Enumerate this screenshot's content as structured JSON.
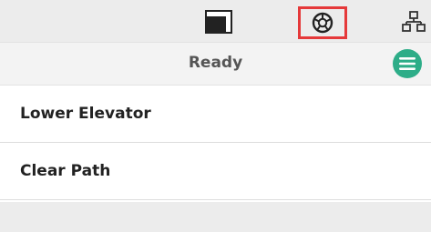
{
  "toolbar": {
    "icons": [
      "window-icon",
      "wheel-icon",
      "network-icon"
    ],
    "highlight_color": "#e5393a"
  },
  "status": {
    "text": "Ready",
    "menu_color": "#2dad88"
  },
  "list": {
    "items": [
      {
        "label": "Lower Elevator"
      },
      {
        "label": "Clear Path"
      }
    ]
  }
}
